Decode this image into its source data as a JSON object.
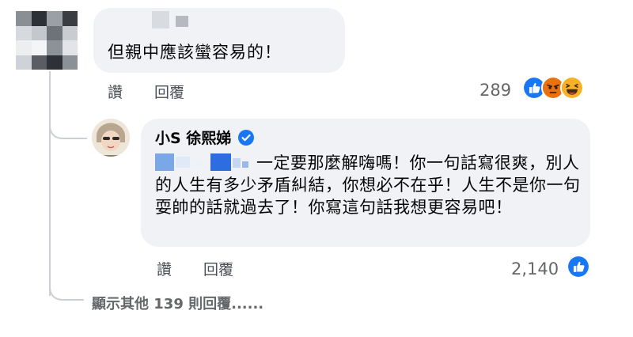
{
  "comment1": {
    "text": "但親中應該蠻容易的！",
    "actions": {
      "like": "讚",
      "reply": "回覆"
    },
    "reaction_count": "289",
    "reactions": [
      "like-icon",
      "angry-icon",
      "haha-icon"
    ]
  },
  "reply": {
    "author": "小S 徐熙娣",
    "verified": true,
    "text": "一定要那麼解嗨嗎！你一句話寫很爽，別人的人生有多少矛盾糾結，你想必不在乎！人生不是你一句耍帥的話就過去了！你寫這句話我想更容易吧！",
    "actions": {
      "like": "讚",
      "reply": "回覆"
    },
    "reaction_count": "2,140",
    "reactions": [
      "like-icon"
    ]
  },
  "more_replies_label": "顯示其他 139 則回覆......",
  "colors": {
    "bubble": "#f0f2f5",
    "facebook_blue": "#1877f2",
    "angry": "#e9710f",
    "haha": "#f7b125",
    "thread_line": "#ccd0d5"
  }
}
